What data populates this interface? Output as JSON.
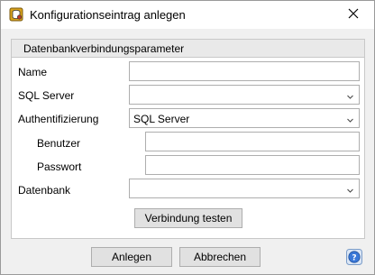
{
  "window": {
    "title": "Konfigurationseintrag anlegen",
    "app_icon": "database-config-icon",
    "close_icon": "close-icon"
  },
  "group": {
    "title": "Datenbankverbindungsparameter"
  },
  "fields": {
    "name_label": "Name",
    "name_value": "",
    "sql_server_label": "SQL Server",
    "sql_server_value": "",
    "auth_label": "Authentifizierung",
    "auth_value": "SQL Server",
    "user_label": "Benutzer",
    "user_value": "",
    "password_label": "Passwort",
    "password_value": "",
    "database_label": "Datenbank",
    "database_value": ""
  },
  "buttons": {
    "test_label": "Verbindung testen",
    "create_label": "Anlegen",
    "cancel_label": "Abbrechen",
    "help_icon": "help-icon"
  },
  "colors": {
    "help_blue": "#3a78d8",
    "group_header_bg": "#e9e9e9",
    "button_bg": "#e1e1e1"
  }
}
